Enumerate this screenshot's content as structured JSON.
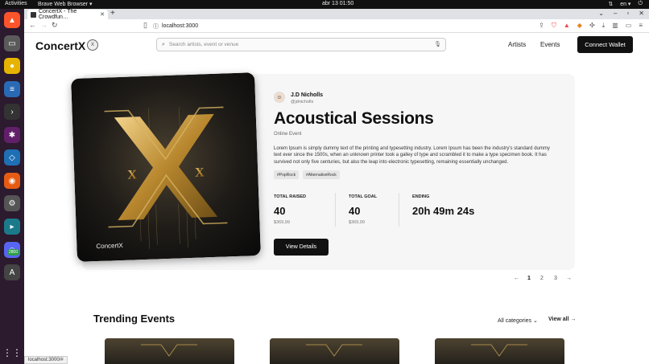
{
  "os": {
    "activities": "Activities",
    "app_name": "Brave Web Browser ▾",
    "clock": "abr 13  01:50",
    "lang": "en ▾",
    "dock_badge": "2800"
  },
  "browser": {
    "tab_title": "ConcertX - The Crowdfun…",
    "url": "localhost:3000",
    "status_url": "localhost:3000/#"
  },
  "header": {
    "logo": "ConcertX",
    "logo_badge": "X",
    "search_placeholder": "Search artists, event or venue",
    "nav": [
      "Artists",
      "Events"
    ],
    "wallet_button": "Connect Wallet"
  },
  "featured": {
    "poster_label": "ConcertX",
    "creator_name": "J.D Nicholls",
    "creator_handle": "@jdnicholls",
    "title": "Acoustical Sessions",
    "type": "Online Event",
    "description": "Lorem Ipsum is simply dummy text of the printing and typesetting industry. Lorem Ipsum has been the industry's standard dummy text ever since the 1500s, when an unknown printer took a galley of type and scrambled it to make a type specimen book. It has survived not only five centuries, but also the leap into electronic typesetting, remaining essentially unchanged.",
    "tags": [
      "#PopRock",
      "#AlternativeRock"
    ],
    "stats": {
      "raised_label": "TOTAL RAISED",
      "raised_value": "40",
      "raised_sub": "$369,99",
      "goal_label": "TOTAL GOAL",
      "goal_value": "40",
      "goal_sub": "$369,99",
      "ending_label": "ENDING",
      "ending_value": "20h 49m 24s"
    },
    "details_button": "View Details"
  },
  "pagination": {
    "prev": "←",
    "pages": [
      "1",
      "2",
      "3"
    ],
    "next": "→"
  },
  "trending": {
    "title": "Trending Events",
    "category": "All categories",
    "view_all": "View all →"
  },
  "colors": {
    "accent": "#111111",
    "poster_gold": "#c9a44a",
    "dock": "#2c1a2e"
  }
}
